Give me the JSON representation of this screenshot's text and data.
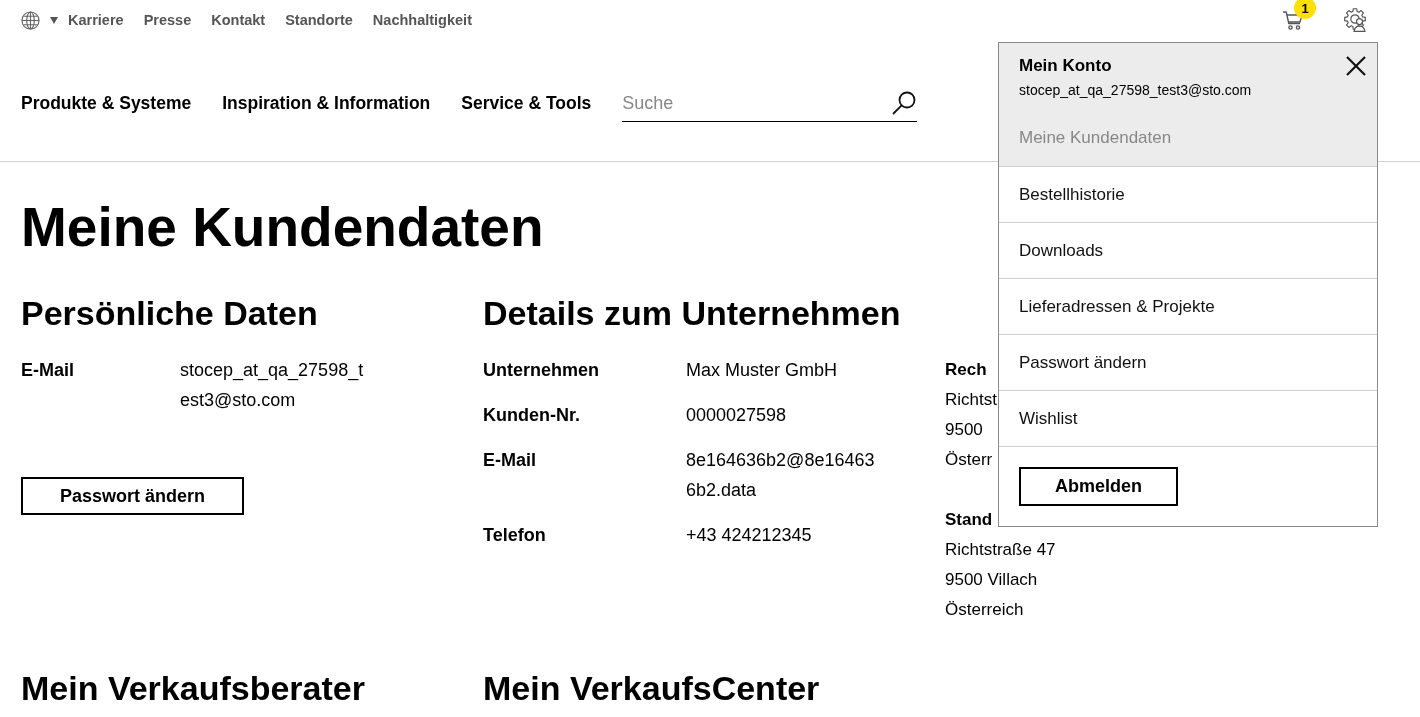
{
  "top_bar": {
    "links": [
      "Karriere",
      "Presse",
      "Kontakt",
      "Standorte",
      "Nachhaltigkeit"
    ],
    "cart_count": "1"
  },
  "main_nav": {
    "items": [
      "Produkte & Systeme",
      "Inspiration & Information",
      "Service & Tools"
    ],
    "search": {
      "placeholder": "Suche"
    }
  },
  "page_title": "Meine Kundendaten",
  "sections": [
    {
      "heading": "Persönliche Daten",
      "fields": [
        {
          "label": "E-Mail",
          "value": "stocep_at_qa_27598_test3@sto.com"
        }
      ],
      "button": "Passwort ändern"
    },
    {
      "heading": "Details zum Unternehmen",
      "fields": [
        {
          "label": "Unternehmen",
          "value": "Max Muster GmbH"
        },
        {
          "label": "Kunden-Nr.",
          "value": "0000027598"
        },
        {
          "label": "E-Mail",
          "value": "8e164636b2@8e164636b2.data"
        },
        {
          "label": "Telefon",
          "value": "+43 424212345"
        }
      ]
    }
  ],
  "addresses": [
    {
      "heading": "Rech",
      "lines": [
        "Richtst",
        "9500",
        "Österr"
      ]
    },
    {
      "heading": "Stand",
      "lines": [
        "Richtstraße 47",
        "9500 Villach",
        "Österreich"
      ]
    }
  ],
  "bottom_sections": [
    {
      "heading": "Mein Verkaufsberater"
    },
    {
      "heading": "Mein VerkaufsCenter"
    }
  ],
  "account_menu": {
    "title": "Mein Konto",
    "email": "stocep_at_qa_27598_test3@sto.com",
    "items": [
      {
        "label": "Meine Kundendaten",
        "selected": true
      },
      {
        "label": "Bestellhistorie",
        "selected": false
      },
      {
        "label": "Downloads",
        "selected": false
      },
      {
        "label": "Lieferadressen & Projekte",
        "selected": false
      },
      {
        "label": "Passwort ändern",
        "selected": false
      },
      {
        "label": "Wishlist",
        "selected": false
      }
    ],
    "logout": "Abmelden"
  }
}
